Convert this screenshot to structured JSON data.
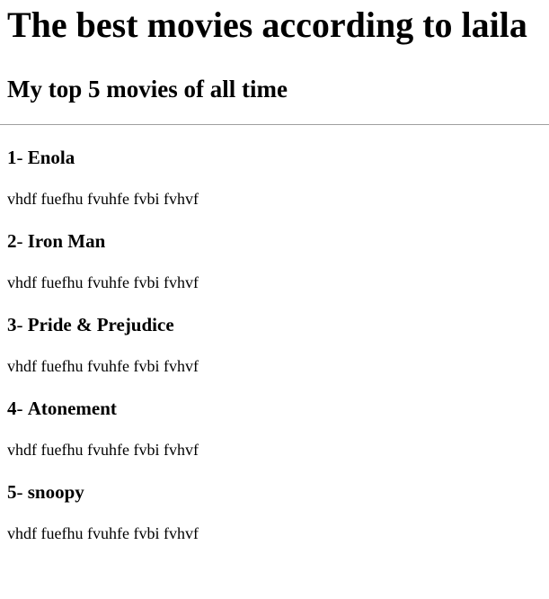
{
  "title": "The best movies according to laila",
  "subtitle": "My top 5 movies of all time",
  "movies": [
    {
      "num": "1",
      "sep": "- ",
      "name": "Enola",
      "desc": "vhdf fuefhu fvuhfe fvbi fvhvf"
    },
    {
      "num": "2",
      "sep": "- ",
      "name": "Iron Man",
      "desc": "vhdf fuefhu fvuhfe fvbi fvhvf"
    },
    {
      "num": "3",
      "sep": "- ",
      "name": "Pride & Prejudice",
      "desc": "vhdf fuefhu fvuhfe fvbi fvhvf"
    },
    {
      "num": "4",
      "sep": "- ",
      "name": "Atonement",
      "desc": "vhdf fuefhu fvuhfe fvbi fvhvf"
    },
    {
      "num": "5",
      "sep": "- ",
      "name": "snoopy",
      "desc": "vhdf fuefhu fvuhfe fvbi fvhvf"
    }
  ]
}
